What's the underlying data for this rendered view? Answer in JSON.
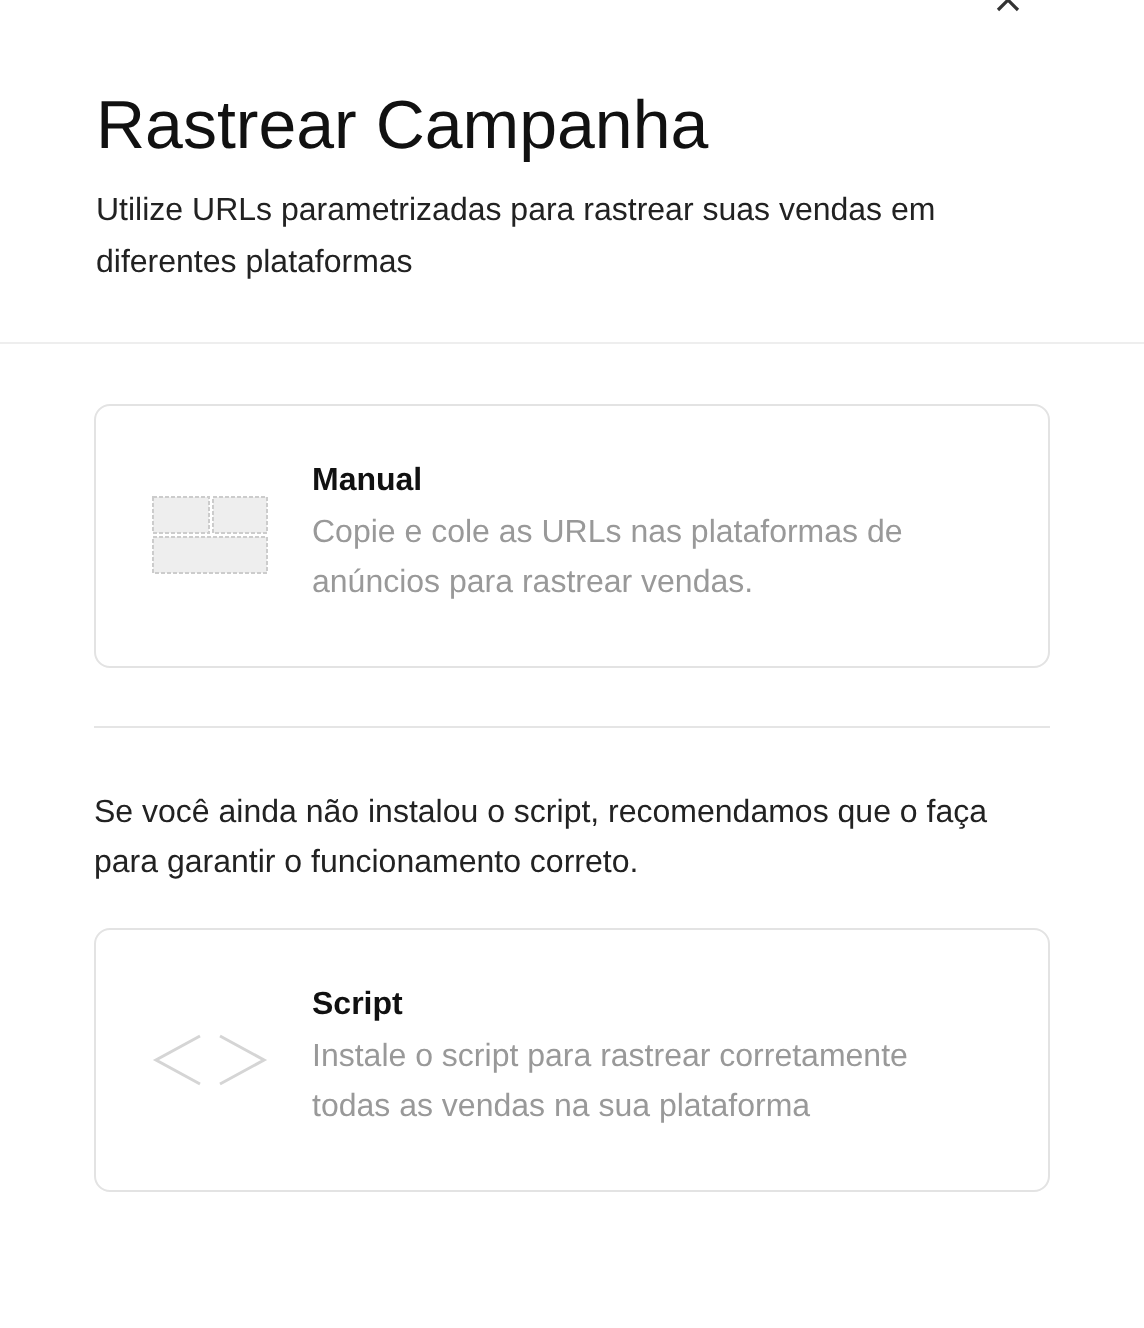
{
  "title": "Rastrear Campanha",
  "subtitle": "Utilize URLs parametrizadas para rastrear suas vendas em diferentes plataformas",
  "options": [
    {
      "kind": "manual",
      "title": "Manual",
      "description": "Copie e cole as URLs nas plataformas de anúncios para rastrear vendas."
    },
    {
      "kind": "script",
      "title": "Script",
      "description": "Instale o script para rastrear corretamente todas as vendas na sua plataforma"
    }
  ],
  "note": "Se você ainda não instalou o script, recomendamos que o faça para garantir o funcionamento correto."
}
